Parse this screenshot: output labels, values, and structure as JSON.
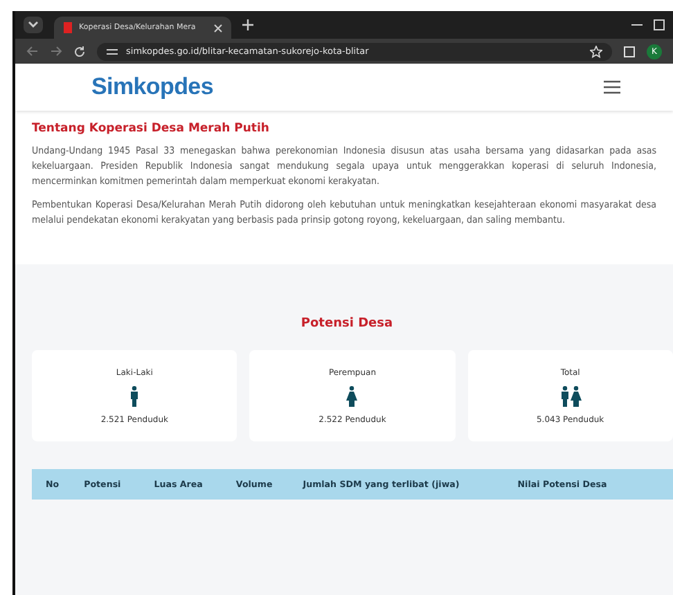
{
  "browser": {
    "tab_title": "Koperasi Desa/Kelurahan Mera",
    "url": "simkopdes.go.id/blitar-kecamatan-sukorejo-kota-blitar",
    "profile_initial": "K"
  },
  "header": {
    "logo": "Simkopdes"
  },
  "about": {
    "title": "Tentang Koperasi Desa Merah Putih",
    "paragraphs": [
      "Undang-Undang 1945 Pasal 33 menegaskan bahwa perekonomian Indonesia disusun atas usaha bersama yang didasarkan pada asas kekeluargaan. Presiden Republik Indonesia sangat mendukung segala upaya untuk menggerakkan koperasi di seluruh Indonesia, mencerminkan komitmen pemerintah dalam memperkuat ekonomi kerakyatan.",
      "Pembentukan Koperasi Desa/Kelurahan Merah Putih didorong oleh kebutuhan untuk meningkatkan kesejahteraan ekonomi masyarakat desa melalui pendekatan ekonomi kerakyatan yang berbasis pada prinsip gotong royong, kekeluargaan, dan saling membantu."
    ]
  },
  "potensi": {
    "title": "Potensi Desa",
    "stats": [
      {
        "kind": "male",
        "label": "Laki-Laki",
        "value": "2.521 Penduduk"
      },
      {
        "kind": "female",
        "label": "Perempuan",
        "value": "2.522 Penduduk"
      },
      {
        "kind": "both",
        "label": "Total",
        "value": "5.043 Penduduk"
      }
    ],
    "table": {
      "columns": [
        "No",
        "Potensi",
        "Luas Area",
        "Volume",
        "Jumlah SDM yang terlibat (jiwa)",
        "Nilai Potensi Desa"
      ]
    }
  }
}
